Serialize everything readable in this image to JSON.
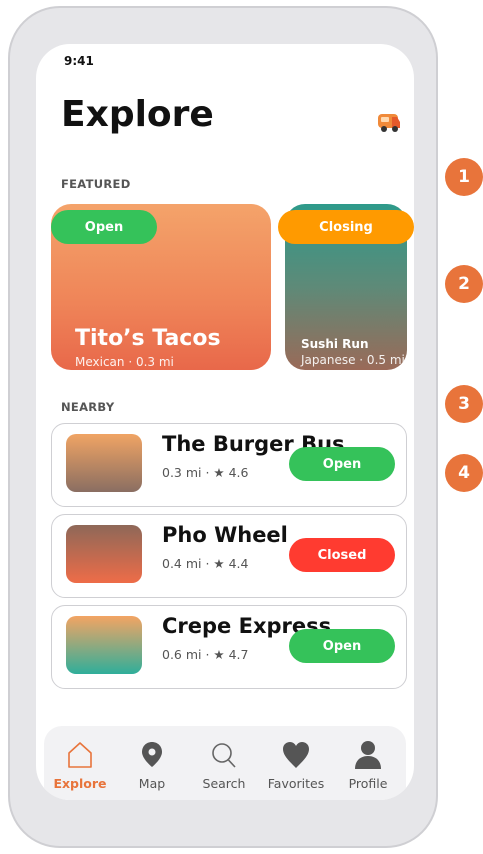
{
  "status": {
    "time": "9:41"
  },
  "header": {
    "title": "Explore",
    "action_icon": "food-truck-icon"
  },
  "featured": {
    "label": "FEATURED",
    "cards": [
      {
        "name": "Tito’s Tacos",
        "subtitle": "Mexican · 0.3 mi",
        "status": "Open",
        "status_color": "#35c25a"
      },
      {
        "name": "Sushi Run",
        "subtitle": "Japanese · 0.5 mi",
        "status": "Closing",
        "status_color": "#ff9a00"
      }
    ]
  },
  "nearby": {
    "label": "NEARBY",
    "items": [
      {
        "name": "The Burger Bus",
        "meta": "0.3 mi · ★ 4.6",
        "status": "Open",
        "status_color": "#35c25a"
      },
      {
        "name": "Pho Wheel",
        "meta": "0.4 mi · ★ 4.4",
        "status": "Closed",
        "status_color": "#ff3b30"
      },
      {
        "name": "Crepe Express",
        "meta": "0.6 mi · ★ 4.7",
        "status": "Open",
        "status_color": "#35c25a"
      }
    ]
  },
  "tabbar": {
    "items": [
      {
        "label": "Explore",
        "icon": "home-icon",
        "active": true
      },
      {
        "label": "Map",
        "icon": "map-pin-icon"
      },
      {
        "label": "Search",
        "icon": "search-icon"
      },
      {
        "label": "Favorites",
        "icon": "heart-icon"
      },
      {
        "label": "Profile",
        "icon": "person-icon"
      }
    ]
  },
  "annotations": [
    "1",
    "2",
    "3",
    "4"
  ],
  "colors": {
    "accent": "#e8743b",
    "open": "#35c25a",
    "closed": "#ff3b30",
    "closing": "#ff9a00"
  }
}
